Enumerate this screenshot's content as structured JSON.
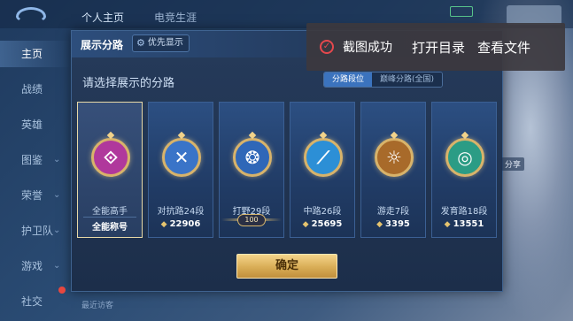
{
  "top_nav": {
    "tabs": [
      "个人主页",
      "电竞生涯"
    ]
  },
  "sidebar": {
    "items": [
      {
        "label": "主页",
        "active": true
      },
      {
        "label": "战绩"
      },
      {
        "label": "英雄"
      },
      {
        "label": "图鉴",
        "chevron": true
      },
      {
        "label": "荣誉",
        "chevron": true
      },
      {
        "label": "护卫队",
        "chevron": true
      },
      {
        "label": "游戏",
        "chevron": true
      },
      {
        "label": "社交"
      }
    ]
  },
  "dialog": {
    "title": "展示分路",
    "priority_button": "优先显示",
    "subtitle": "请选择展示的分路",
    "segments": [
      {
        "label": "分路段位",
        "active": true
      },
      {
        "label": "巅峰分路(全国)",
        "active": false
      }
    ],
    "cards": [
      {
        "name": "全能高手",
        "value": "全能称号",
        "emblem_color": "#b0389c",
        "glyph": "⟐",
        "selected": true
      },
      {
        "name": "对抗路24段",
        "value": "22906",
        "emblem_color": "#3a74c8",
        "glyph": "✕"
      },
      {
        "name": "打野29段",
        "value": "100",
        "emblem_color": "#2f67b8",
        "glyph": "❂",
        "level_badge": true
      },
      {
        "name": "中路26段",
        "value": "25695",
        "emblem_color": "#2c8fd6",
        "glyph": "⟋"
      },
      {
        "name": "游走7段",
        "value": "3395",
        "emblem_color": "#a86a2a",
        "glyph": "☼"
      },
      {
        "name": "发育路18段",
        "value": "13551",
        "emblem_color": "#2b9c85",
        "glyph": "◎"
      }
    ],
    "confirm_label": "确定"
  },
  "toast": {
    "message": "截图成功",
    "open_folder": "打开目录",
    "view_file": "查看文件"
  },
  "bottom": {
    "recent_label": "最近访客"
  },
  "right_side": {
    "chip": "分享"
  }
}
